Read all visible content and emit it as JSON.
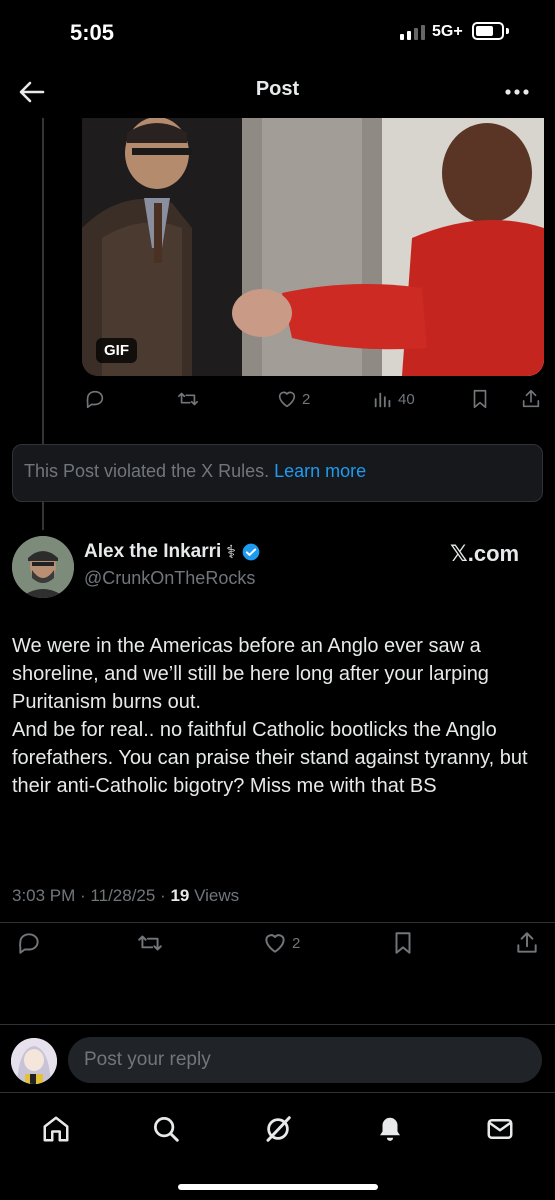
{
  "status_bar": {
    "time": "5:05",
    "network": "5G+"
  },
  "header": {
    "title": "Post"
  },
  "media": {
    "badge": "GIF"
  },
  "quoted_actions": {
    "likes": "2",
    "views": "40"
  },
  "violation": {
    "text": "This Post violated the X Rules.",
    "link": "Learn more"
  },
  "author": {
    "name": "Alex the Inkarri",
    "name_emoji": "⚕",
    "handle": "@CrunkOnTheRocks",
    "source_label": "𝕏.com"
  },
  "post": {
    "lines": [
      "We were in the Americas before an Anglo ever saw a shoreline, and we’ll still be here long after your larping Puritanism burns out.",
      "And be for real.. no faithful Catholic bootlicks the Anglo forefathers. You can praise their stand against tyranny, but their anti-Catholic bigotry? Miss me with that BS"
    ],
    "time": "3:03 PM · 11/28/25 · ",
    "views_count": "19",
    "views_label": " Views"
  },
  "post_actions": {
    "likes": "2"
  },
  "reply": {
    "placeholder": "Post your reply"
  },
  "colors": {
    "accent": "#1d9bf0",
    "muted": "#71767b",
    "text": "#e7e9ea",
    "background": "#000000"
  },
  "icons": [
    "back-arrow-icon",
    "more-icon",
    "reply-icon",
    "repost-icon",
    "like-icon",
    "views-icon",
    "bookmark-icon",
    "share-icon",
    "verified-icon",
    "home-icon",
    "search-icon",
    "grok-icon",
    "notifications-icon",
    "messages-icon"
  ]
}
